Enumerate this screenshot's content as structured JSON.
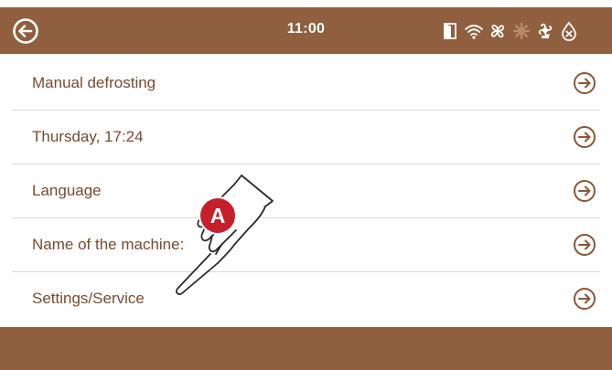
{
  "header": {
    "time": "11:00",
    "status_icons": [
      "door-icon",
      "wifi-icon",
      "fan-icon",
      "defrost-icon",
      "compressor-icon",
      "water-off-icon"
    ]
  },
  "menu": {
    "items": [
      {
        "label": "Manual defrosting"
      },
      {
        "label": "Thursday, 17:24"
      },
      {
        "label": "Language"
      },
      {
        "label": "Name of the machine:"
      },
      {
        "label": "Settings/Service"
      }
    ]
  },
  "callout": {
    "badge": "A"
  },
  "colors": {
    "bar": "#8f5f3f",
    "text": "#7a4a2d",
    "divider": "#d9d9d9",
    "badge": "#c41f2b"
  }
}
